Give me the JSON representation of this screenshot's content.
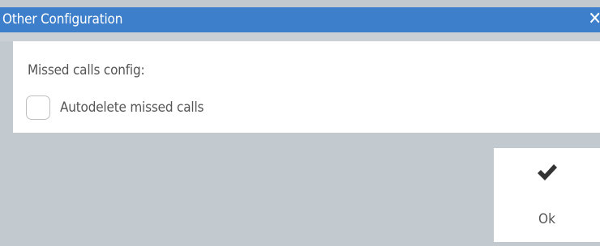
{
  "dialog": {
    "title": "Other Configuration",
    "close_icon": "close-icon"
  },
  "content": {
    "section_label": "Missed calls config:",
    "autodelete": {
      "label": "Autodelete missed calls",
      "checked": false
    }
  },
  "actions": {
    "ok_label": "Ok",
    "ok_icon": "checkmark-icon"
  },
  "colors": {
    "title_bar": "#3e7fcb",
    "background": "#c2c9cf",
    "panel": "#ffffff",
    "text": "#555555"
  }
}
